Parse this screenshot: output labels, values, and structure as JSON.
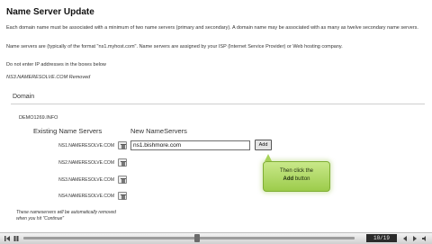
{
  "page": {
    "title": "Name Server Update",
    "paragraphs": [
      "Each domain name must be associated with a minimum of two name servers (primary and secondary). A domain name may be associated with as many as twelve secondary name servers.",
      "Name servers are (typically of the format \"ns1.myhost.com\". Name servers are assigned by your ISP (Internet Service Provider) or Web hosting company.",
      "Do not enter IP addresses in the boxes below",
      "NS3.NAMERESOLVE.COM Removed"
    ]
  },
  "domain_section": {
    "label": "Domain",
    "domain_name": "DEMO1269.INFO",
    "existing_header": "Existing Name Servers",
    "new_header": "New NameServers",
    "existing": [
      "NS1.NAMERESOLVE.COM",
      "NS2.NAMERESOLVE.COM",
      "NS3.NAMERESOLVE.COM",
      "NS4.NAMERESOLVE.COM"
    ],
    "new_input_value": "ns1.bishmore.com",
    "add_label": "Add"
  },
  "callout": {
    "line1": "Then click the",
    "bold": "Add",
    "line2_rest": " button"
  },
  "footer_note": "These nameservers will be automatically removed when you hit \"Continue\"",
  "player": {
    "counter": "10/19"
  },
  "colors": {
    "callout_fill": "#b4dc6a",
    "callout_border": "#7fae33"
  }
}
